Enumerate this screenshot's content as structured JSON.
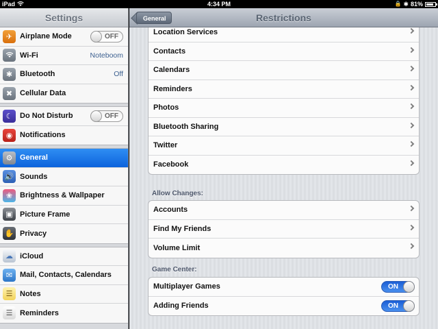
{
  "statusbar": {
    "device": "iPad",
    "time": "4:34 PM",
    "battery": "81%",
    "battery_level": 0.81,
    "icons": [
      "wifi-icon",
      "lock-icon",
      "bluetooth-icon",
      "battery-icon"
    ]
  },
  "sidebar": {
    "title": "Settings",
    "groups": [
      [
        {
          "label": "Airplane Mode",
          "icon": "airplane-icon",
          "toggle": "OFF"
        },
        {
          "label": "Wi-Fi",
          "icon": "wifi-icon",
          "value": "Noteboom"
        },
        {
          "label": "Bluetooth",
          "icon": "bluetooth-icon",
          "value": "Off"
        },
        {
          "label": "Cellular Data",
          "icon": "cellular-icon"
        }
      ],
      [
        {
          "label": "Do Not Disturb",
          "icon": "moon-icon",
          "toggle": "OFF"
        },
        {
          "label": "Notifications",
          "icon": "notifications-icon"
        }
      ],
      [
        {
          "label": "General",
          "icon": "gear-icon",
          "selected": true
        },
        {
          "label": "Sounds",
          "icon": "speaker-icon"
        },
        {
          "label": "Brightness & Wallpaper",
          "icon": "flower-icon"
        },
        {
          "label": "Picture Frame",
          "icon": "picture-frame-icon"
        },
        {
          "label": "Privacy",
          "icon": "hand-icon"
        }
      ],
      [
        {
          "label": "iCloud",
          "icon": "cloud-icon"
        },
        {
          "label": "Mail, Contacts, Calendars",
          "icon": "mail-icon"
        },
        {
          "label": "Notes",
          "icon": "notes-icon"
        },
        {
          "label": "Reminders",
          "icon": "reminders-icon"
        }
      ]
    ]
  },
  "navbar": {
    "back_label": "General",
    "title": "Restrictions"
  },
  "privacy_list": {
    "items": [
      "Location Services",
      "Contacts",
      "Calendars",
      "Reminders",
      "Photos",
      "Bluetooth Sharing",
      "Twitter",
      "Facebook"
    ]
  },
  "allow_changes": {
    "label": "Allow Changes:",
    "items": [
      "Accounts",
      "Find My Friends",
      "Volume Limit"
    ]
  },
  "game_center": {
    "label": "Game Center:",
    "items": [
      {
        "label": "Multiplayer Games",
        "toggle": "ON"
      },
      {
        "label": "Adding Friends",
        "toggle": "ON"
      }
    ]
  },
  "colors": {
    "selected": "#1a6fe6",
    "toggle_on": "#2f76e0"
  }
}
